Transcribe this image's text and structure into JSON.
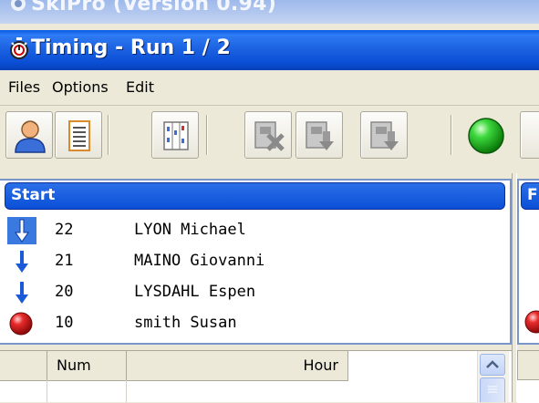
{
  "background_window": {
    "title": "SkiPro (Version 0.94)"
  },
  "window": {
    "title": "Timing -   Run 1 / 2"
  },
  "menubar": {
    "items": [
      "Files",
      "Options",
      "Edit"
    ]
  },
  "toolbar": {
    "buttons": [
      {
        "icon": "person-icon"
      },
      {
        "icon": "document-icon"
      },
      {
        "icon": "columns-settings-icon"
      },
      {
        "icon": "delete-record-icon",
        "enabled": false
      },
      {
        "icon": "download-record-icon",
        "enabled": false
      },
      {
        "icon": "download-record-2-icon",
        "enabled": false
      },
      {
        "icon": "green-light-icon"
      }
    ]
  },
  "start_panel": {
    "header": "Start",
    "rows": [
      {
        "icon": "arrow-down-icon",
        "selected": true,
        "num": "22",
        "name": "LYON Michael"
      },
      {
        "icon": "arrow-down-icon",
        "selected": false,
        "num": "21",
        "name": "MAINO Giovanni"
      },
      {
        "icon": "arrow-down-icon",
        "selected": false,
        "num": "20",
        "name": "LYSDAHL Espen"
      },
      {
        "icon": "red-circle-icon",
        "selected": false,
        "num": "10",
        "name": "smith Susan"
      }
    ]
  },
  "right_panel": {
    "header": "F"
  },
  "grid": {
    "columns": [
      "",
      "Num",
      "Hour"
    ]
  },
  "colors": {
    "title_blue": "#0a4fd6",
    "panel_header_blue": "#2b6fe8",
    "face": "#ece9d8",
    "selection": "#3a7ae0"
  }
}
